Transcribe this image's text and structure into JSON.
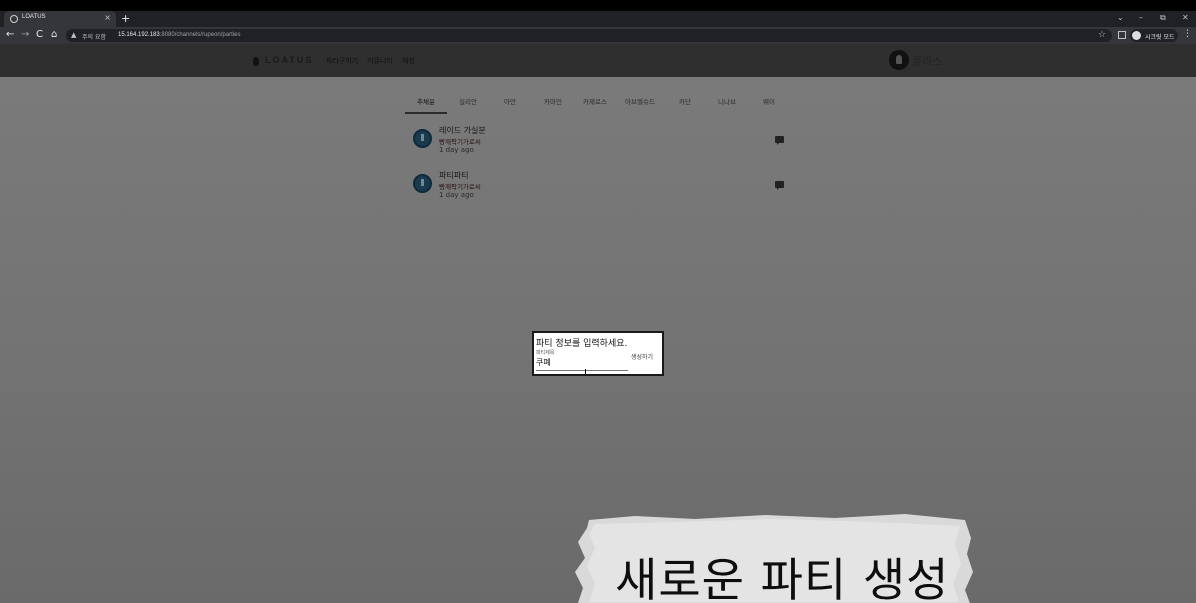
{
  "browser": {
    "tab_title": "LOATUS",
    "tab_close": "×",
    "new_tab": "+",
    "window_controls": [
      "⌄",
      "–",
      "⧉",
      "✕"
    ],
    "nav_buttons": [
      "←",
      "→",
      "C",
      "⌂"
    ],
    "security_warning": "주의 요함",
    "url_host": "15.164.192.183",
    "url_port": ":8080",
    "url_path": "/channels/rupeon/parties",
    "star": "☆",
    "profile_label": "시크릿 모드",
    "menu": "⋮"
  },
  "site": {
    "logo": "LOATUS",
    "nav": [
      "파티구하기",
      "커뮤니티",
      "매칭"
    ],
    "user_name": "룰라스"
  },
  "content_tabs": [
    "추채윤",
    "실리안",
    "아만",
    "카마인",
    "카제로스",
    "아브렐슈드",
    "카단",
    "니나브",
    "웨이"
  ],
  "parties": [
    {
      "title": "레이드 가실분",
      "owner": "빵깨팍기가로씨",
      "time": "1 day ago"
    },
    {
      "title": "파티파티",
      "owner": "빵깨팍기가로씨",
      "time": "1 day ago"
    }
  ],
  "dialog": {
    "title": "파티 정보를 입력하세요.",
    "field_label": "파티제목",
    "field_value": "쿠폐",
    "create_button": "생성하기"
  },
  "caption": "새로운 파티 생성"
}
